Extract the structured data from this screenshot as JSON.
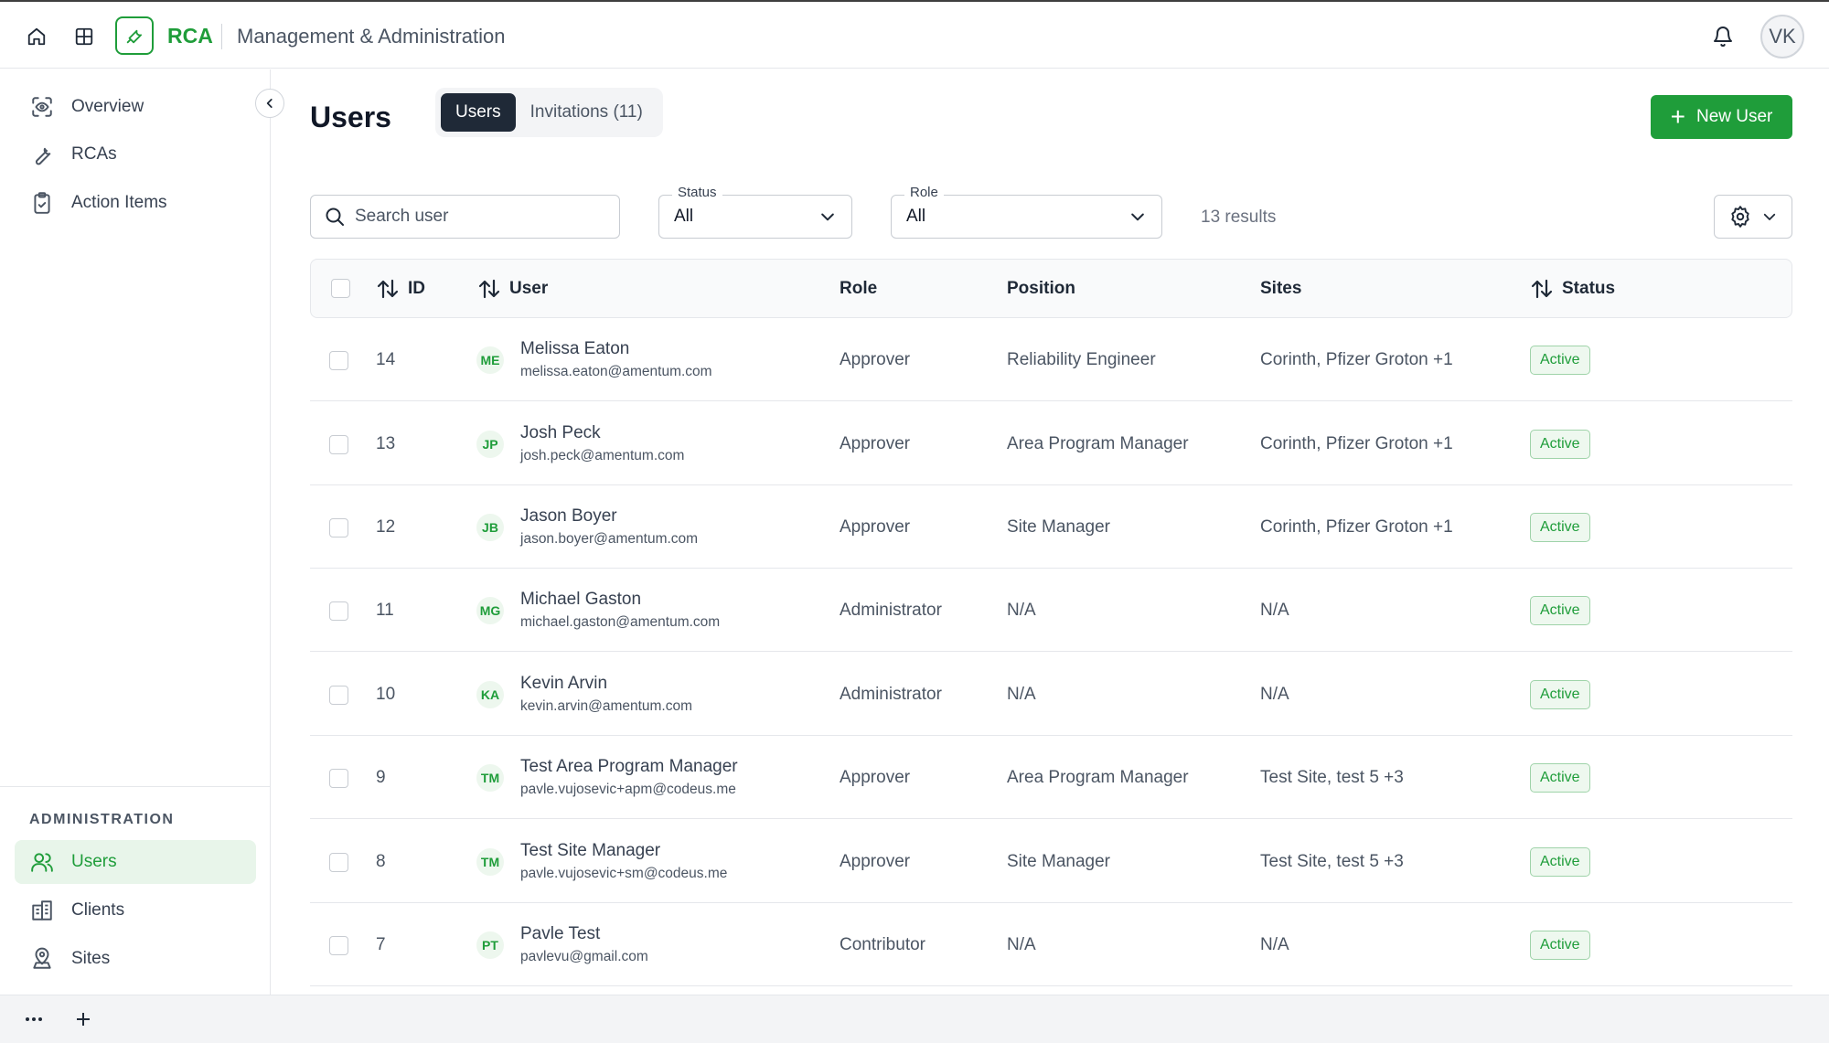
{
  "header": {
    "brand": "RCA",
    "subtitle": "Management & Administration",
    "user_initials": "VK"
  },
  "sidebar": {
    "main_items": [
      {
        "label": "Overview",
        "icon": "eye-scan-icon"
      },
      {
        "label": "RCAs",
        "icon": "wrench-icon"
      },
      {
        "label": "Action Items",
        "icon": "clipboard-check-icon"
      }
    ],
    "section_label": "ADMINISTRATION",
    "admin_items": [
      {
        "label": "Users",
        "icon": "users-icon",
        "active": true
      },
      {
        "label": "Clients",
        "icon": "building-icon",
        "active": false
      },
      {
        "label": "Sites",
        "icon": "map-pin-icon",
        "active": false
      }
    ]
  },
  "page": {
    "title": "Users",
    "tabs": [
      {
        "label": "Users",
        "active": true
      },
      {
        "label": "Invitations (11)",
        "active": false
      }
    ],
    "new_button": "New User"
  },
  "filters": {
    "search_placeholder": "Search user",
    "status_label": "Status",
    "status_value": "All",
    "role_label": "Role",
    "role_value": "All",
    "results": "13 results"
  },
  "table": {
    "headers": {
      "id": "ID",
      "user": "User",
      "role": "Role",
      "position": "Position",
      "sites": "Sites",
      "status": "Status"
    },
    "rows": [
      {
        "id": "14",
        "initials": "ME",
        "name": "Melissa Eaton",
        "email": "melissa.eaton@amentum.com",
        "role": "Approver",
        "position": "Reliability Engineer",
        "sites": "Corinth, Pfizer Groton +1",
        "status": "Active"
      },
      {
        "id": "13",
        "initials": "JP",
        "name": "Josh Peck",
        "email": "josh.peck@amentum.com",
        "role": "Approver",
        "position": "Area Program Manager",
        "sites": "Corinth, Pfizer Groton +1",
        "status": "Active"
      },
      {
        "id": "12",
        "initials": "JB",
        "name": "Jason Boyer",
        "email": "jason.boyer@amentum.com",
        "role": "Approver",
        "position": "Site Manager",
        "sites": "Corinth, Pfizer Groton +1",
        "status": "Active"
      },
      {
        "id": "11",
        "initials": "MG",
        "name": "Michael Gaston",
        "email": "michael.gaston@amentum.com",
        "role": "Administrator",
        "position": "N/A",
        "sites": "N/A",
        "status": "Active"
      },
      {
        "id": "10",
        "initials": "KA",
        "name": "Kevin Arvin",
        "email": "kevin.arvin@amentum.com",
        "role": "Administrator",
        "position": "N/A",
        "sites": "N/A",
        "status": "Active"
      },
      {
        "id": "9",
        "initials": "TM",
        "name": "Test Area Program Manager",
        "email": "pavle.vujosevic+apm@codeus.me",
        "role": "Approver",
        "position": "Area Program Manager",
        "sites": "Test Site, test 5 +3",
        "status": "Active"
      },
      {
        "id": "8",
        "initials": "TM",
        "name": "Test Site Manager",
        "email": "pavle.vujosevic+sm@codeus.me",
        "role": "Approver",
        "position": "Site Manager",
        "sites": "Test Site, test 5 +3",
        "status": "Active"
      },
      {
        "id": "7",
        "initials": "PT",
        "name": "Pavle Test",
        "email": "pavlevu@gmail.com",
        "role": "Contributor",
        "position": "N/A",
        "sites": "N/A",
        "status": "Active"
      }
    ]
  },
  "colors": {
    "accent": "#1f9d3a",
    "dark": "#1f2937"
  }
}
